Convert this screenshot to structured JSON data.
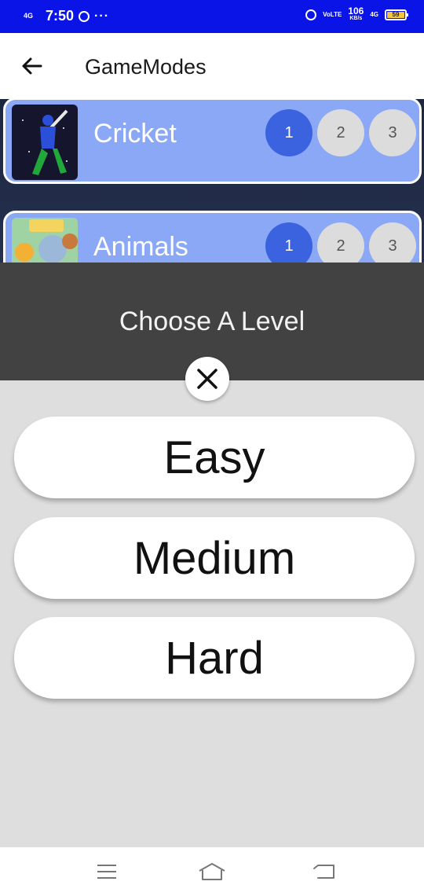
{
  "status_bar": {
    "network": "4G",
    "time": "7:50",
    "more": "···",
    "volte": "VoLTE",
    "speed_value": "106",
    "speed_unit": "KB/s",
    "network2": "4G",
    "battery": "59"
  },
  "app_bar": {
    "title": "GameModes",
    "back_icon": "arrow-left-icon"
  },
  "games": [
    {
      "name": "Cricket",
      "levels": [
        "1",
        "2",
        "3"
      ],
      "selected_level": "1",
      "thumb": "cricket-player-image"
    },
    {
      "name": "Animals",
      "levels": [
        "1",
        "2",
        "3"
      ],
      "selected_level": "1",
      "thumb": "zoo-animals-image"
    }
  ],
  "dialog": {
    "title": "Choose A Level",
    "close_icon": "close-icon",
    "options": [
      "Easy",
      "Medium",
      "Hard"
    ]
  },
  "nav_bar": {
    "icons": [
      "menu-icon",
      "home-icon",
      "back-icon"
    ]
  },
  "colors": {
    "status_bar": "#0a14e6",
    "card": "#8aa8f5",
    "selected_level": "#3b63e0",
    "dialog_header": "#424242",
    "dialog_body": "#dedede"
  }
}
